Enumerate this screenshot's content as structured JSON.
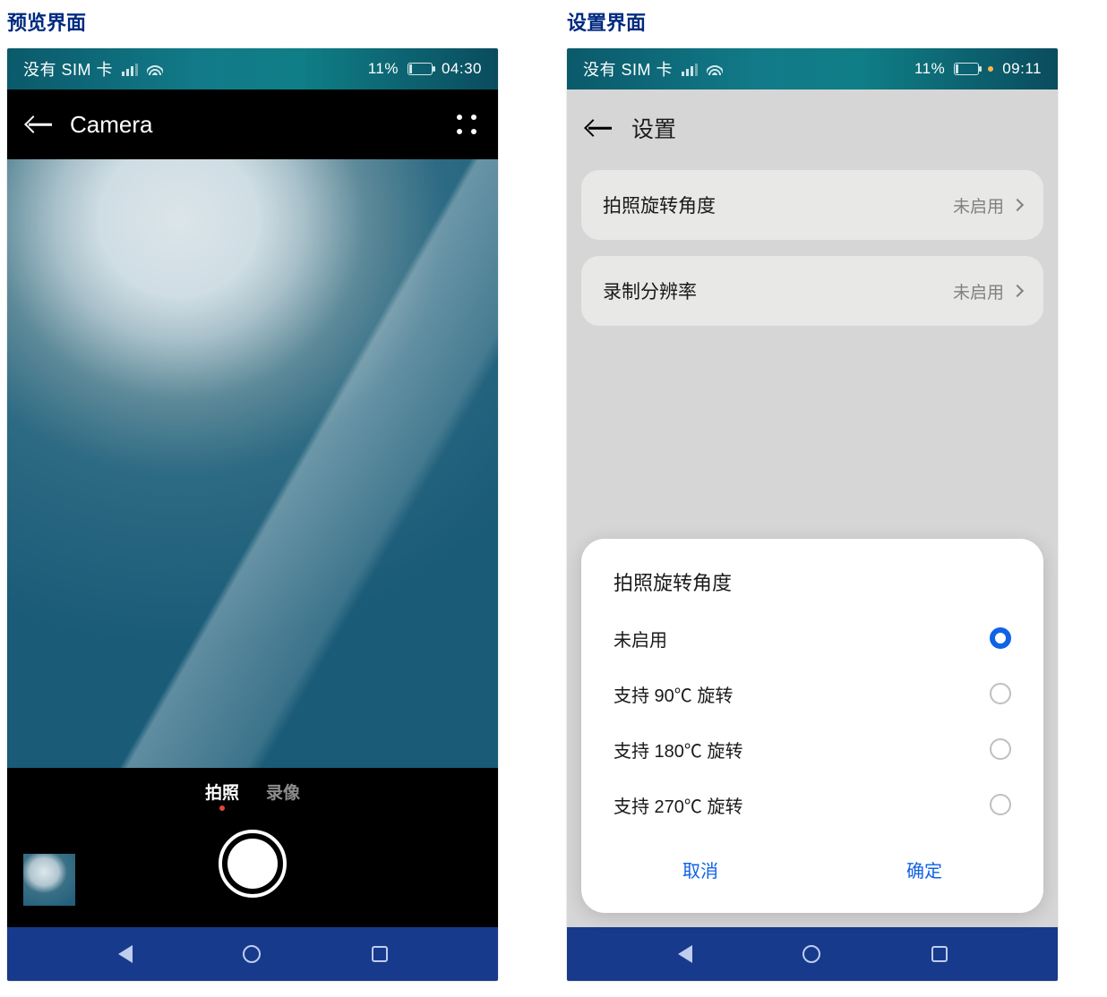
{
  "left": {
    "caption": "预览界面",
    "status": {
      "sim_text": "没有 SIM 卡",
      "battery_pct": "11%",
      "time": "04:30"
    },
    "header": {
      "title": "Camera"
    },
    "modes": {
      "photo": "拍照",
      "video": "录像"
    }
  },
  "right": {
    "caption": "设置界面",
    "status": {
      "sim_text": "没有 SIM 卡",
      "battery_pct": "11%",
      "time": "09:11"
    },
    "header": {
      "title": "设置"
    },
    "items": [
      {
        "label": "拍照旋转角度",
        "value": "未启用"
      },
      {
        "label": "录制分辨率",
        "value": "未启用"
      }
    ],
    "sheet": {
      "title": "拍照旋转角度",
      "options": [
        {
          "label": "未启用",
          "selected": true
        },
        {
          "label": "支持 90℃ 旋转",
          "selected": false
        },
        {
          "label": "支持 180℃ 旋转",
          "selected": false
        },
        {
          "label": "支持 270℃ 旋转",
          "selected": false
        }
      ],
      "cancel": "取消",
      "ok": "确定"
    }
  }
}
